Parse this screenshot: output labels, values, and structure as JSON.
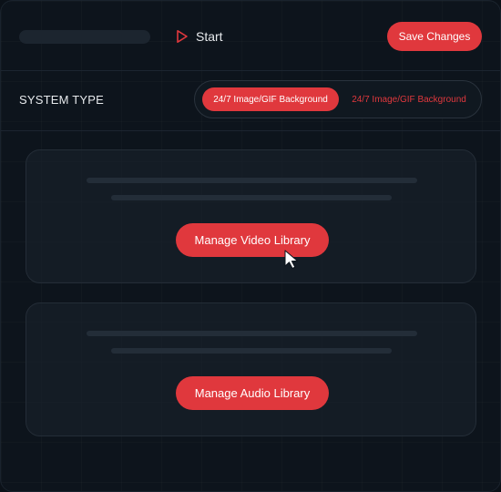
{
  "header": {
    "start_label": "Start",
    "save_label": "Save Changes"
  },
  "system_type": {
    "label": "SYSTEM TYPE",
    "options": [
      {
        "label": "24/7 Image/GIF Background",
        "selected": true
      },
      {
        "label": "24/7 Image/GIF Background",
        "selected": false
      }
    ]
  },
  "cards": [
    {
      "button_label": "Manage Video Library"
    },
    {
      "button_label": "Manage Audio Library"
    }
  ],
  "colors": {
    "accent": "#e0383d",
    "background": "#0d141c",
    "card": "#182029"
  },
  "icons": {
    "start": "play-icon",
    "cursor": "mouse-pointer-icon"
  }
}
